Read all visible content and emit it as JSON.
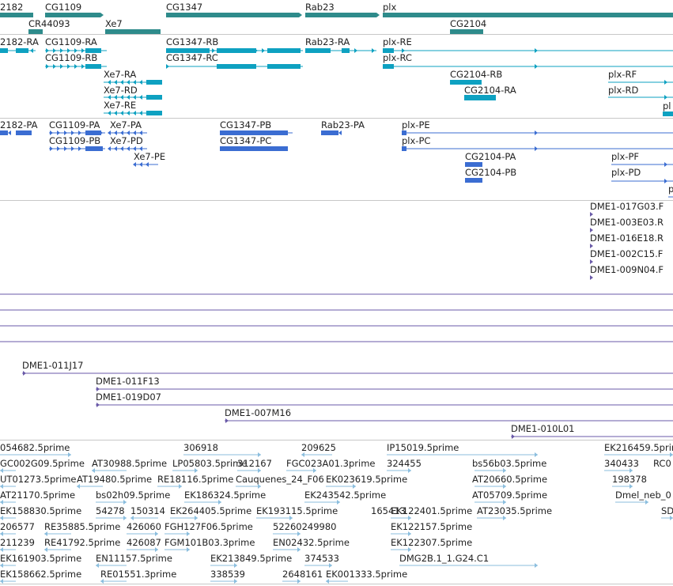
{
  "colors": {
    "gene": "#2e8b8b",
    "transcript": "#0ea1c1",
    "protein": "#3b6dd2",
    "bac": "#6a5aa8",
    "est": "#8bbede",
    "separator": "#c8c8c8"
  },
  "genes": [
    {
      "label": "2182"
    },
    {
      "label": "CG1109"
    },
    {
      "label": "CR44093"
    },
    {
      "label": "Xe7"
    },
    {
      "label": "CG1347"
    },
    {
      "label": "Rab23"
    },
    {
      "label": "plx"
    },
    {
      "label": "CG2104"
    }
  ],
  "transcripts": [
    {
      "label": "2182-RA"
    },
    {
      "label": "CG1109-RA"
    },
    {
      "label": "CG1109-RB"
    },
    {
      "label": "CG1347-RB"
    },
    {
      "label": "CG1347-RC"
    },
    {
      "label": "Rab23-RA"
    },
    {
      "label": "plx-RE"
    },
    {
      "label": "plx-RC"
    },
    {
      "label": "Xe7-RA"
    },
    {
      "label": "Xe7-RD"
    },
    {
      "label": "Xe7-RE"
    },
    {
      "label": "CG2104-RB"
    },
    {
      "label": "CG2104-RA"
    },
    {
      "label": "plx-RF"
    },
    {
      "label": "plx-RD"
    },
    {
      "label": "pl"
    }
  ],
  "proteins": [
    {
      "label": "2182-PA"
    },
    {
      "label": "CG1109-PA"
    },
    {
      "label": "Xe7-PA"
    },
    {
      "label": "CG1347-PB"
    },
    {
      "label": "Rab23-PA"
    },
    {
      "label": "plx-PE"
    },
    {
      "label": "CG1109-PB"
    },
    {
      "label": "Xe7-PD"
    },
    {
      "label": "CG1347-PC"
    },
    {
      "label": "plx-PC"
    },
    {
      "label": "Xe7-PE"
    },
    {
      "label": "CG2104-PA"
    },
    {
      "label": "plx-PF"
    },
    {
      "label": "CG2104-PB"
    },
    {
      "label": "plx-PD"
    },
    {
      "label": "p"
    }
  ],
  "bac_right": [
    {
      "label": "DME1-017G03.F"
    },
    {
      "label": "DME1-003E03.R"
    },
    {
      "label": "DME1-016E18.R"
    },
    {
      "label": "DME1-002C15.F"
    },
    {
      "label": "DME1-009N04.F"
    }
  ],
  "bac_lines": [
    {
      "label": "DME1-011J17"
    },
    {
      "label": "DME1-011F13"
    },
    {
      "label": "DME1-019D07"
    },
    {
      "label": "DME1-007M16"
    },
    {
      "label": "DME1-010L01"
    }
  ],
  "ests": [
    {
      "label": "054682.5prime"
    },
    {
      "label": "306918"
    },
    {
      "label": "209625"
    },
    {
      "label": "IP15019.5prime"
    },
    {
      "label": "EK216459.5prime"
    },
    {
      "label": "GC002G09.5prime"
    },
    {
      "label": "AT30988.5prime"
    },
    {
      "label": "LP05803.5prime"
    },
    {
      "label": "312167"
    },
    {
      "label": "FGC023A01.3prime"
    },
    {
      "label": "324455"
    },
    {
      "label": "bs56b03.5prime"
    },
    {
      "label": "340433"
    },
    {
      "label": "RC0"
    },
    {
      "label": "UT01273.5prime"
    },
    {
      "label": "AT19480.5prime"
    },
    {
      "label": "RE18116.5prime"
    },
    {
      "label": "Cauquenes_24_F06"
    },
    {
      "label": "EK023619.5prime"
    },
    {
      "label": "AT20660.5prime"
    },
    {
      "label": "198378"
    },
    {
      "label": "AT21170.5prime"
    },
    {
      "label": "bs02h09.5prime"
    },
    {
      "label": "EK186324.5prime"
    },
    {
      "label": "EK243542.5prime"
    },
    {
      "label": "AT05709.5prime"
    },
    {
      "label": "Dmel_neb_0"
    },
    {
      "label": "EK158830.5prime"
    },
    {
      "label": "54278"
    },
    {
      "label": "150314"
    },
    {
      "label": "EK264405.5prime"
    },
    {
      "label": "EK193115.5prime"
    },
    {
      "label": "165413"
    },
    {
      "label": "EK122401.5prime"
    },
    {
      "label": "AT23035.5prime"
    },
    {
      "label": "SD"
    },
    {
      "label": "206577"
    },
    {
      "label": "RE35885.5prime"
    },
    {
      "label": "426060"
    },
    {
      "label": "FGH127F06.5prime"
    },
    {
      "label": "52260249980"
    },
    {
      "label": "EK122157.5prime"
    },
    {
      "label": "211239"
    },
    {
      "label": "RE41792.5prime"
    },
    {
      "label": "426087"
    },
    {
      "label": "FGM101B03.3prime"
    },
    {
      "label": "EN02432.5prime"
    },
    {
      "label": "EK122307.5prime"
    },
    {
      "label": "EK161903.5prime"
    },
    {
      "label": "EN11157.5prime"
    },
    {
      "label": "EK213849.5prime"
    },
    {
      "label": "374533"
    },
    {
      "label": "DMG2B.1_1.G24.C1"
    },
    {
      "label": "EK158662.5prime"
    },
    {
      "label": "RE01551.3prime"
    },
    {
      "label": "338539"
    },
    {
      "label": "2648161"
    },
    {
      "label": "EK001333.5prime"
    }
  ]
}
